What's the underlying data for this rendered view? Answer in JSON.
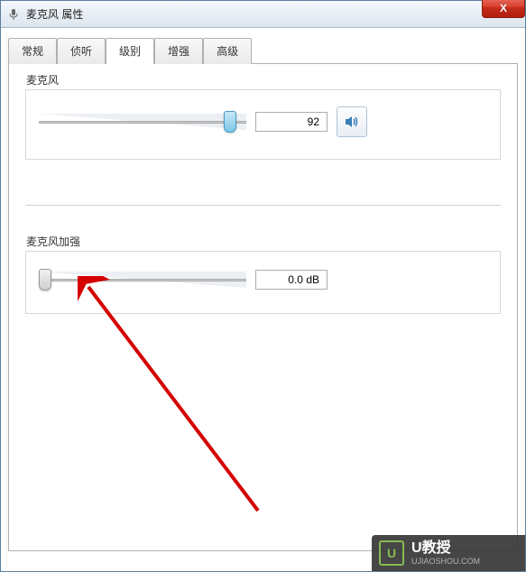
{
  "window": {
    "title": "麦克风 属性",
    "close_symbol": "X"
  },
  "tabs": {
    "items": [
      {
        "label": "常规"
      },
      {
        "label": "侦听"
      },
      {
        "label": "级别"
      },
      {
        "label": "增强"
      },
      {
        "label": "高级"
      }
    ],
    "active_index": 2
  },
  "microphone": {
    "label": "麦克风",
    "value": "92",
    "slider_percent": 92
  },
  "boost": {
    "label": "麦克风加强",
    "value": "0.0 dB",
    "slider_percent": 0
  },
  "watermark": {
    "brand": "U教授",
    "url": "UJIAOSHOU.COM",
    "logo_letter": "U"
  }
}
